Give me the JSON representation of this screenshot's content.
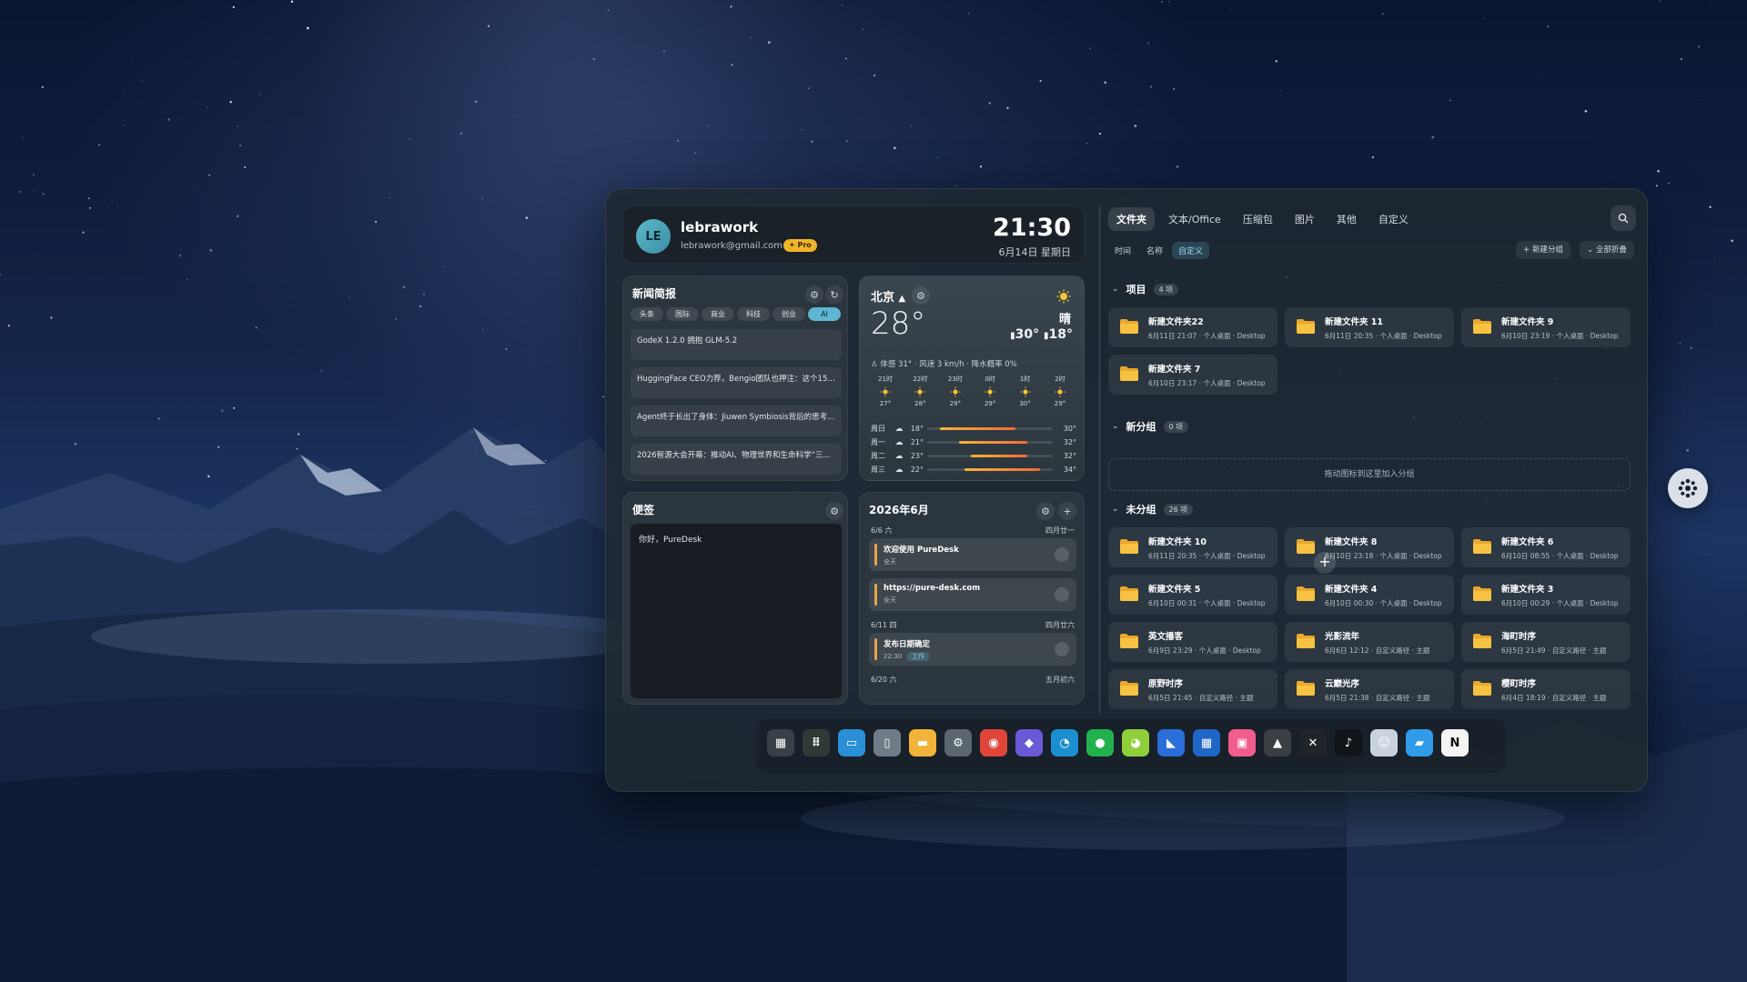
{
  "profile": {
    "initials": "LE",
    "name": "lebrawork",
    "email": "lebrawork@gmail.com",
    "badge": "✦ Pro",
    "time": "21:30",
    "date": "6月14日 星期日"
  },
  "news": {
    "title": "新闻简报",
    "categories": [
      "头条",
      "国际",
      "商业",
      "科技",
      "创业",
      "AI"
    ],
    "active_category": "AI",
    "items": [
      "GodeX 1.2.0 拥抱 GLM-5.2",
      "HuggingFace CEO力荐，Bengio团队也押注：这个1500...",
      "Agent终于长出了身体：Jiuwen Symbiosis背后的思考...",
      "2026智源大会开幕：推动AI、物理世界和生命科学“三..."
    ]
  },
  "notes": {
    "title": "便签",
    "content": "你好，PureDesk"
  },
  "weather": {
    "city": "北京",
    "condition": "晴",
    "temp": "28°",
    "high": "30°",
    "low": "18°",
    "detail": "体感 31° · 风速 3 km/h · 降水概率 0%",
    "hourly": [
      {
        "time": "21时",
        "temp": "27°"
      },
      {
        "time": "22时",
        "temp": "28°"
      },
      {
        "time": "23时",
        "temp": "29°"
      },
      {
        "time": "0时",
        "temp": "29°"
      },
      {
        "time": "1时",
        "temp": "30°"
      },
      {
        "time": "2时",
        "temp": "29°"
      }
    ],
    "daily": [
      {
        "day": "周日",
        "lo": "18°",
        "hi": "30°",
        "lo_num": 18,
        "hi_num": 30
      },
      {
        "day": "周一",
        "lo": "21°",
        "hi": "32°",
        "lo_num": 21,
        "hi_num": 32
      },
      {
        "day": "周二",
        "lo": "23°",
        "hi": "32°",
        "lo_num": 23,
        "hi_num": 32
      },
      {
        "day": "周三",
        "lo": "22°",
        "hi": "34°",
        "lo_num": 22,
        "hi_num": 34
      }
    ]
  },
  "calendar": {
    "title": "2026年6月",
    "groups": [
      {
        "date": "6/6 六",
        "lunar": "四月廿一",
        "events": [
          {
            "title": "欢迎使用 PureDesk",
            "sub": "全天",
            "tag": ""
          },
          {
            "title": "https://pure-desk.com",
            "sub": "全天",
            "tag": ""
          }
        ]
      },
      {
        "date": "6/11 四",
        "lunar": "四月廿六",
        "events": [
          {
            "title": "发布日期确定",
            "sub": "22:30",
            "tag": "工作"
          }
        ]
      },
      {
        "date": "6/20 六",
        "lunar": "五月初六",
        "events": []
      }
    ]
  },
  "files": {
    "tabs": [
      "文件夹",
      "文本/Office",
      "压缩包",
      "图片",
      "其他",
      "自定义"
    ],
    "active_tab": "文件夹",
    "sorts": [
      "时间",
      "名称",
      "自定义"
    ],
    "active_sort": "自定义",
    "new_group": "+ 新建分组",
    "collapse_all": "⌄ 全部折叠",
    "groups": [
      {
        "name": "项目",
        "count": "4 项",
        "items": [
          {
            "name": "新建文件夹22",
            "meta": "6月11日 21:07 · 个人桌面 · Desktop"
          },
          {
            "name": "新建文件夹 11",
            "meta": "6月11日 20:35 · 个人桌面 · Desktop"
          },
          {
            "name": "新建文件夹 9",
            "meta": "6月10日 23:19 · 个人桌面 · Desktop"
          },
          {
            "name": "新建文件夹 7",
            "meta": "6月10日 23:17 · 个人桌面 · Desktop"
          }
        ]
      },
      {
        "name": "新分组",
        "count": "0 项",
        "drop_hint": "拖动图标到这里加入分组"
      },
      {
        "name": "未分组",
        "count": "26 项",
        "items": [
          {
            "name": "新建文件夹 10",
            "meta": "6月11日 20:35 · 个人桌面 · Desktop"
          },
          {
            "name": "新建文件夹 8",
            "meta": "6月10日 23:18 · 个人桌面 · Desktop"
          },
          {
            "name": "新建文件夹 6",
            "meta": "6月10日 08:55 · 个人桌面 · Desktop"
          },
          {
            "name": "新建文件夹 5",
            "meta": "6月10日 00:31 · 个人桌面 · Desktop"
          },
          {
            "name": "新建文件夹 4",
            "meta": "6月10日 00:30 · 个人桌面 · Desktop"
          },
          {
            "name": "新建文件夹 3",
            "meta": "6月10日 00:29 · 个人桌面 · Desktop"
          },
          {
            "name": "英文播客",
            "meta": "6月9日 23:29 · 个人桌面 · Desktop"
          },
          {
            "name": "光影流年",
            "meta": "6月6日 12:12 · 自定义路径 · 主题"
          },
          {
            "name": "海町时序",
            "meta": "6月5日 21:49 · 自定义路径 · 主题"
          },
          {
            "name": "原野时序",
            "meta": "6月5日 21:45 · 自定义路径 · 主题"
          },
          {
            "name": "云巅光序",
            "meta": "6月5日 21:38 · 自定义路径 · 主题"
          },
          {
            "name": "樱町时序",
            "meta": "6月4日 18:19 · 自定义路径 · 主题"
          }
        ]
      }
    ]
  },
  "dock": [
    {
      "name": "puredesk",
      "color": "#3a4048",
      "glyph": "▦"
    },
    {
      "name": "app-cluster",
      "color": "#2f3a36",
      "glyph": "⠿"
    },
    {
      "name": "desktop",
      "color": "#2a8fd6",
      "glyph": "▭"
    },
    {
      "name": "recycle-bin",
      "color": "#6f7b86",
      "glyph": "▯"
    },
    {
      "name": "file-explorer",
      "color": "#f2b33a",
      "glyph": "▬"
    },
    {
      "name": "settings",
      "color": "#5b6670",
      "glyph": "⚙"
    },
    {
      "name": "chrome",
      "color": "#e0453a",
      "glyph": "◉"
    },
    {
      "name": "copilot",
      "color": "#6a5ad8",
      "glyph": "◆"
    },
    {
      "name": "edge",
      "color": "#1b8fd0",
      "glyph": "◔"
    },
    {
      "name": "wechat",
      "color": "#23b14d",
      "glyph": "●"
    },
    {
      "name": "chat-app",
      "color": "#8fcf3a",
      "glyph": "◕"
    },
    {
      "name": "feishu",
      "color": "#2a6fd9",
      "glyph": "◣"
    },
    {
      "name": "ms-store",
      "color": "#1f66c7",
      "glyph": "▦"
    },
    {
      "name": "bilibili",
      "color": "#f25d8e",
      "glyph": "▣"
    },
    {
      "name": "box-app",
      "color": "#3b3f44",
      "glyph": "▲"
    },
    {
      "name": "capcut",
      "color": "#202428",
      "glyph": "✕"
    },
    {
      "name": "tiktok",
      "color": "#111418",
      "glyph": "♪"
    },
    {
      "name": "avatar-app",
      "color": "#c9d3dd",
      "glyph": "☺"
    },
    {
      "name": "finder",
      "color": "#2f9be9",
      "glyph": "▰"
    },
    {
      "name": "notion",
      "color": "#f4f4f4",
      "glyph": "N"
    }
  ],
  "colors": {
    "accent": "#5eb6d2",
    "pro": "#f0b429",
    "folder": "#f5b935",
    "event_bar": "#e8a24a"
  }
}
